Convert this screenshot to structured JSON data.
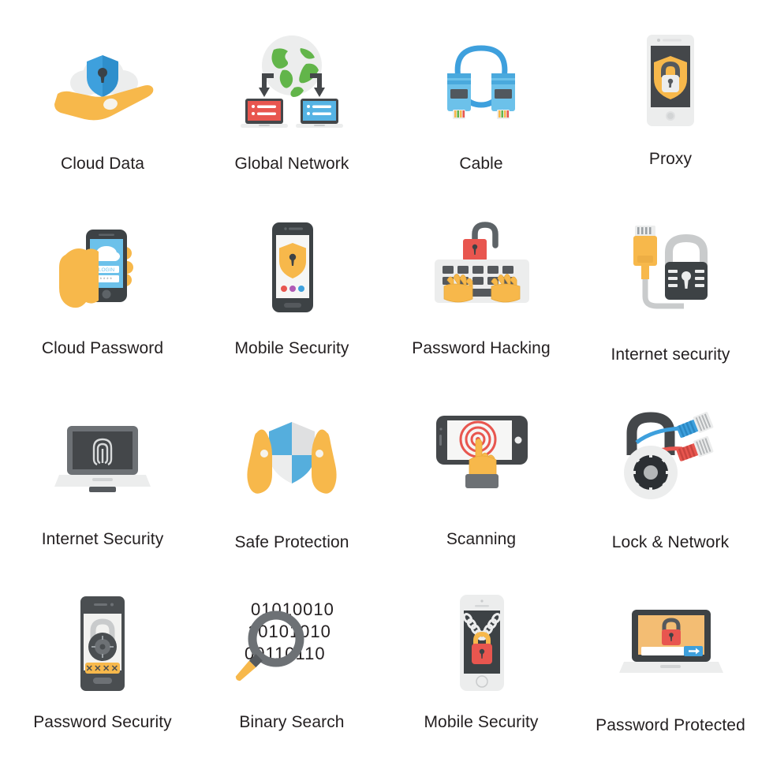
{
  "grid": {
    "columns": 4,
    "rows": 4,
    "background": "#ffffff",
    "label_color": "#231f20"
  },
  "palette": {
    "yellow": "#f7b84b",
    "yellow_light": "#fac55e",
    "blue": "#3ea0dd",
    "blue_light": "#6cc1ea",
    "red": "#e8564f",
    "red_light": "#ee6f63",
    "dark": "#44474a",
    "dark_soft": "#555a5e",
    "gray": "#c9cbcc",
    "gray_light": "#e9eaeb",
    "green": "#62b54a",
    "white": "#ffffff"
  },
  "icons": [
    {
      "id": "cloud-data",
      "label": "Cloud Data",
      "art": "hand-holding-cloud-shield",
      "colors": [
        "#f7b84b",
        "#e9eaeb",
        "#3ea0dd"
      ]
    },
    {
      "id": "global-network",
      "label": "Global Network",
      "art": "globe-with-two-laptops",
      "colors": [
        "#62b54a",
        "#e8564f",
        "#3ea0dd",
        "#44474a"
      ]
    },
    {
      "id": "cable",
      "label": "Cable",
      "art": "ethernet-cable-loop",
      "colors": [
        "#3ea0dd",
        "#6cc1ea",
        "#f7b84b"
      ]
    },
    {
      "id": "proxy",
      "label": "Proxy",
      "art": "tablet-with-shield-lock",
      "colors": [
        "#e9eaeb",
        "#44474a",
        "#f7b84b"
      ]
    },
    {
      "id": "cloud-password",
      "label": "Cloud Password",
      "art": "hand-holding-phone-cloud-login",
      "screen_text": "LOGIN",
      "password_mask": "* * * *",
      "colors": [
        "#f7b84b",
        "#44474a",
        "#3ea0dd"
      ]
    },
    {
      "id": "mobile-security",
      "label": "Mobile Security",
      "art": "dark-phone-shield",
      "colors": [
        "#44474a",
        "#f7b84b",
        "#e8564f",
        "#b05ab5",
        "#3ea0dd"
      ]
    },
    {
      "id": "password-hacking",
      "label": "Password Hacking",
      "art": "keyboard-hands-open-lock",
      "colors": [
        "#e9eaeb",
        "#f7b84b",
        "#e8564f",
        "#555a5e"
      ]
    },
    {
      "id": "internet-security-lock",
      "label": "Internet security",
      "art": "rj45-cable-padlock",
      "colors": [
        "#f7b84b",
        "#c9cbcc",
        "#44474a"
      ]
    },
    {
      "id": "internet-security-laptop",
      "label": "Internet Security",
      "art": "laptop-fingerprint",
      "colors": [
        "#6d7175",
        "#44474a",
        "#e9eaeb"
      ]
    },
    {
      "id": "safe-protection",
      "label": "Safe Protection",
      "art": "two-hands-shield",
      "colors": [
        "#f7b84b",
        "#3ea0dd",
        "#e9eaeb"
      ]
    },
    {
      "id": "scanning",
      "label": "Scanning",
      "art": "tablet-touch-radar",
      "colors": [
        "#44474a",
        "#e8564f",
        "#f7b84b"
      ]
    },
    {
      "id": "lock-network",
      "label": "Lock & Network",
      "art": "combination-lock-two-cables",
      "colors": [
        "#44474a",
        "#3ea0dd",
        "#e8564f",
        "#e9eaeb"
      ]
    },
    {
      "id": "password-security",
      "label": "Password Security",
      "art": "phone-dial-lock-password-field",
      "password_mask": "✕ ✕ ✕ ✕",
      "colors": [
        "#44474a",
        "#f7b84b",
        "#6d7175"
      ]
    },
    {
      "id": "binary-search",
      "label": "Binary Search",
      "art": "magnifier-over-binary",
      "binary_rows": [
        "01010010",
        "10101010",
        "00110110"
      ],
      "colors": [
        "#231f20",
        "#6d7175",
        "#f7b84b"
      ]
    },
    {
      "id": "mobile-security-chain",
      "label": "Mobile Security",
      "art": "white-phone-chain-padlock",
      "colors": [
        "#eceded",
        "#44474a",
        "#e8564f",
        "#f7b84b"
      ]
    },
    {
      "id": "password-protected",
      "label": "Password Protected",
      "art": "laptop-login-lock",
      "colors": [
        "#44474a",
        "#f3bd73",
        "#e8564f",
        "#3ea0dd"
      ]
    }
  ]
}
